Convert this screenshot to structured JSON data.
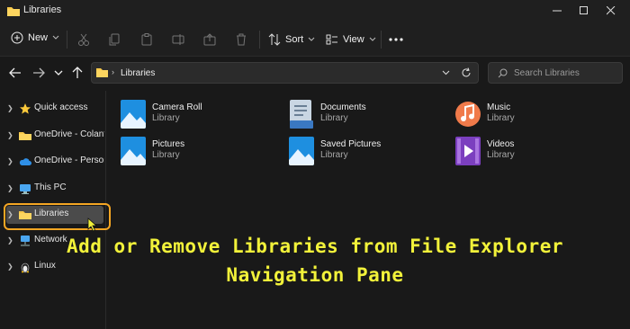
{
  "window": {
    "title": "Libraries"
  },
  "toolbar": {
    "new_label": "New",
    "sort_label": "Sort",
    "view_label": "View"
  },
  "address": {
    "path": "Libraries"
  },
  "search": {
    "placeholder": "Search Libraries"
  },
  "nav": {
    "items": [
      {
        "label": "Quick access",
        "icon": "star-icon"
      },
      {
        "label": "OneDrive - Colantuc",
        "icon": "folder-icon"
      },
      {
        "label": "OneDrive - Personal",
        "icon": "cloud-icon"
      },
      {
        "label": "This PC",
        "icon": "monitor-icon"
      },
      {
        "label": "Libraries",
        "icon": "folder-icon",
        "selected": true
      },
      {
        "label": "Network",
        "icon": "network-icon"
      },
      {
        "label": "Linux",
        "icon": "penguin-icon"
      }
    ]
  },
  "libraries": [
    {
      "name": "Camera Roll",
      "type": "Library",
      "icon": "picture-library-icon"
    },
    {
      "name": "Documents",
      "type": "Library",
      "icon": "documents-library-icon"
    },
    {
      "name": "Music",
      "type": "Library",
      "icon": "music-library-icon"
    },
    {
      "name": "Pictures",
      "type": "Library",
      "icon": "picture-library-icon"
    },
    {
      "name": "Saved Pictures",
      "type": "Library",
      "icon": "picture-library-icon"
    },
    {
      "name": "Videos",
      "type": "Library",
      "icon": "videos-library-icon"
    }
  ],
  "caption": {
    "line1": "Add or Remove Libraries from File Explorer",
    "line2": "Navigation Pane"
  },
  "colors": {
    "background": "#191919",
    "highlight": "#f5a623",
    "caption": "#f2f23a",
    "accent": "#0a84d8"
  }
}
